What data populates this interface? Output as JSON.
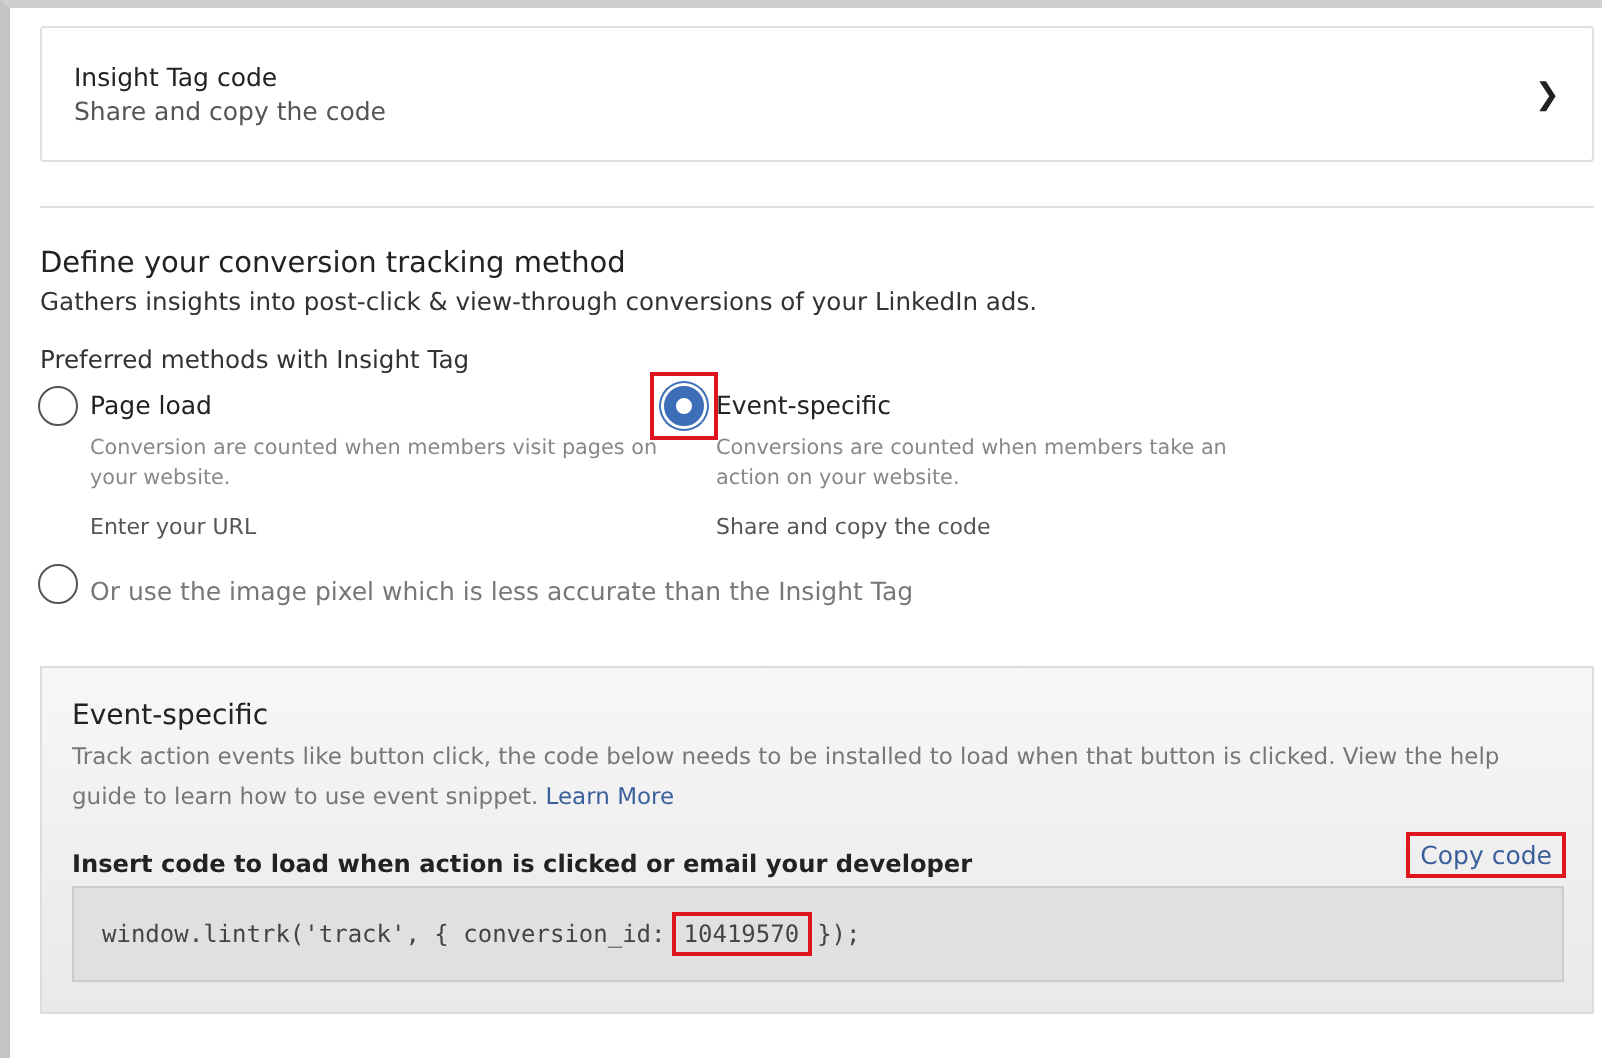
{
  "insight_card": {
    "title": "Insight Tag code",
    "subtitle": "Share and copy the code",
    "chevron": "❯"
  },
  "tracking": {
    "heading": "Define your conversion tracking method",
    "description": "Gathers insights into post-click & view-through conversions of your LinkedIn ads.",
    "methods_label": "Preferred methods with Insight Tag",
    "options": [
      {
        "label": "Page load",
        "description": "Conversion are counted when members visit pages on your website.",
        "action": "Enter your URL",
        "selected": false,
        "highlighted": false
      },
      {
        "label": "Event-specific",
        "description": "Conversions are counted when members take an action on your website.",
        "action": "Share and copy the code",
        "selected": true,
        "highlighted": true
      }
    ],
    "pixel_option": {
      "label": "Or use the image pixel which is less accurate than the Insight Tag",
      "selected": false
    }
  },
  "event_panel": {
    "title": "Event-specific",
    "description": "Track action events like button click, the code below needs to be installed to load when that button is clicked. View the help guide to learn how to use event snippet.",
    "link": "Learn More",
    "code_label": "Insert code to load when action is clicked or email your developer",
    "copy_button": {
      "label": "Copy code",
      "highlighted": true
    },
    "code": {
      "prefix": "window.lintrk('track', { conversion_id:",
      "conversion_id": "10419570",
      "suffix": "});",
      "id_highlighted": true
    }
  }
}
